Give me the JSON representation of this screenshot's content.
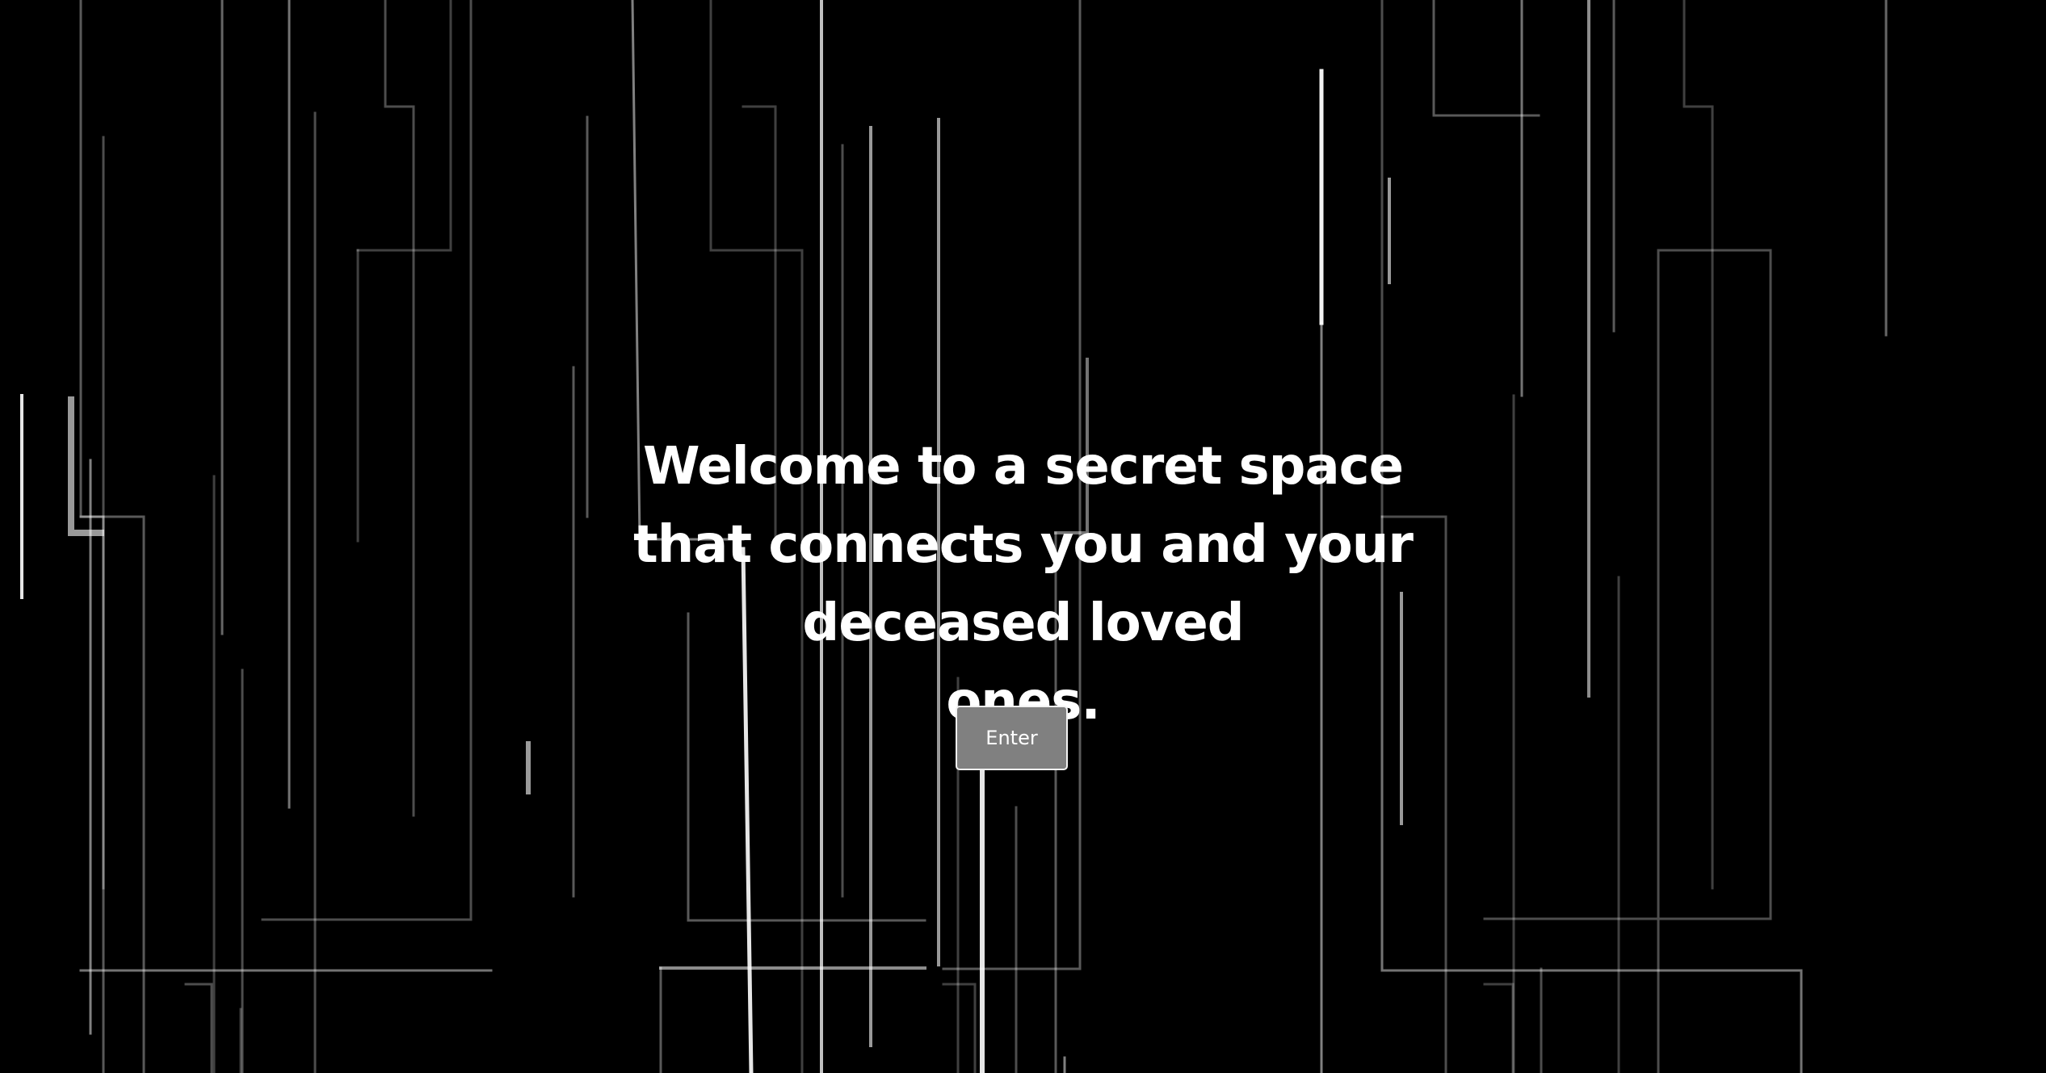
{
  "hero": {
    "line1": "Welcome to a secret space",
    "line2": "that connects you and your deceased loved",
    "line3": "ones."
  },
  "enter_button": {
    "label": "Enter"
  },
  "colors": {
    "background": "#000000",
    "text": "#ffffff",
    "button_fill": "#808080",
    "button_border": "#f2f2f2",
    "line_color": "#ffffff"
  }
}
